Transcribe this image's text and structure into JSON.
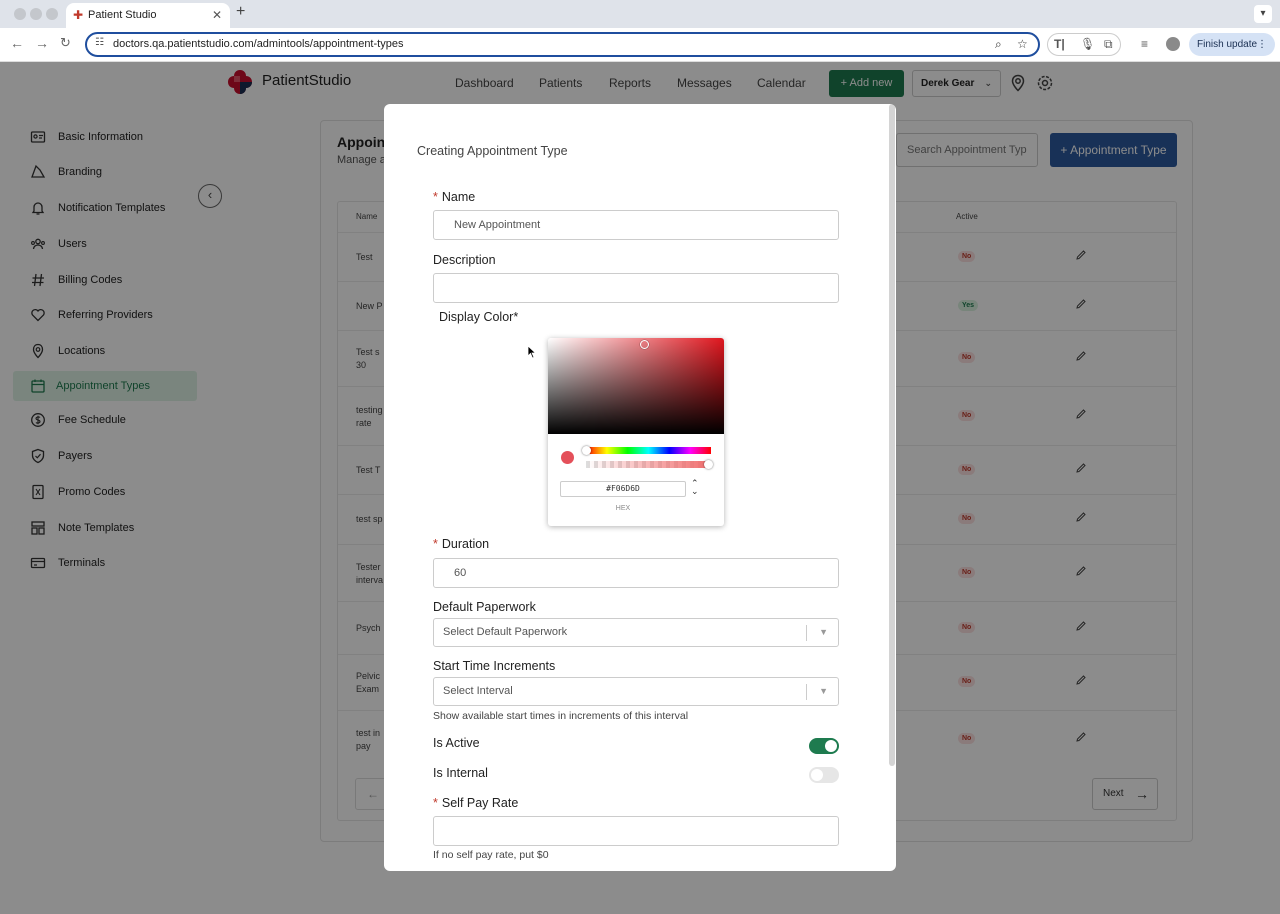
{
  "browser": {
    "tab_title": "Patient Studio",
    "tab_close": "✕",
    "new_tab": "+",
    "url": "doctors.qa.patientstudio.com/admintools/appointment-types",
    "finish_update": "Finish update"
  },
  "header": {
    "brand": "PatientStudio",
    "nav": [
      "Dashboard",
      "Patients",
      "Reports",
      "Messages",
      "Calendar"
    ],
    "add_new": "+ Add new",
    "user_name": "Derek Gear"
  },
  "sidebar": {
    "items": [
      {
        "label": "Basic Information",
        "icon": "id-card-icon"
      },
      {
        "label": "Branding",
        "icon": "branding-icon"
      },
      {
        "label": "Notification Templates",
        "icon": "bell-icon"
      },
      {
        "label": "Users",
        "icon": "users-icon"
      },
      {
        "label": "Billing Codes",
        "icon": "hash-icon"
      },
      {
        "label": "Referring Providers",
        "icon": "heart-icon"
      },
      {
        "label": "Locations",
        "icon": "location-icon"
      },
      {
        "label": "Appointment Types",
        "icon": "calendar-icon",
        "active": true
      },
      {
        "label": "Fee Schedule",
        "icon": "dollar-icon"
      },
      {
        "label": "Payers",
        "icon": "shield-icon"
      },
      {
        "label": "Promo Codes",
        "icon": "promo-icon"
      },
      {
        "label": "Note Templates",
        "icon": "template-icon"
      },
      {
        "label": "Terminals",
        "icon": "card-icon"
      }
    ]
  },
  "page": {
    "title": "Appoin",
    "subtitle": "Manage a",
    "search_placeholder": "Search Appointment Typ",
    "add_button": "+ Appointment Type",
    "columns": {
      "name": "Name",
      "active": "Active"
    },
    "rows": [
      {
        "name": "Test",
        "name2": "",
        "active": "No"
      },
      {
        "name": "New P",
        "name2": "",
        "active": "Yes"
      },
      {
        "name": "Test s",
        "name2": "30",
        "active": "No"
      },
      {
        "name": "testing",
        "name2": "rate",
        "active": "No"
      },
      {
        "name": "Test T",
        "name2": "",
        "active": "No"
      },
      {
        "name": "test sp",
        "name2": "",
        "active": "No"
      },
      {
        "name": "Tester",
        "name2": "interva",
        "active": "No"
      },
      {
        "name": "Psych",
        "name2": "",
        "active": "No"
      },
      {
        "name": "Pelvic",
        "name2": "Exam",
        "active": "No"
      },
      {
        "name": "test in",
        "name2": "pay",
        "active": "No"
      }
    ],
    "next": "Next"
  },
  "modal": {
    "title": "Creating Appointment Type",
    "name_label": "Name",
    "name_placeholder": "New Appointment",
    "description_label": "Description",
    "display_color_label": "Display Color*",
    "color_hex": "#F06D6D",
    "hex_label": "HEX",
    "duration_label": "Duration",
    "duration_value": "60",
    "paperwork_label": "Default Paperwork",
    "paperwork_placeholder": "Select Default Paperwork",
    "increments_label": "Start Time Increments",
    "increments_placeholder": "Select Interval",
    "increments_hint": "Show available start times in increments of this interval",
    "is_active_label": "Is Active",
    "is_active": true,
    "is_internal_label": "Is Internal",
    "is_internal": false,
    "self_pay_label": "Self Pay Rate",
    "self_pay_hint": "If no self pay rate, put $0",
    "required_mark": "*"
  },
  "colors": {
    "accent_green": "#1e7b4f",
    "primary_blue": "#2c5a9e",
    "selected_color": "#F06D6D"
  }
}
